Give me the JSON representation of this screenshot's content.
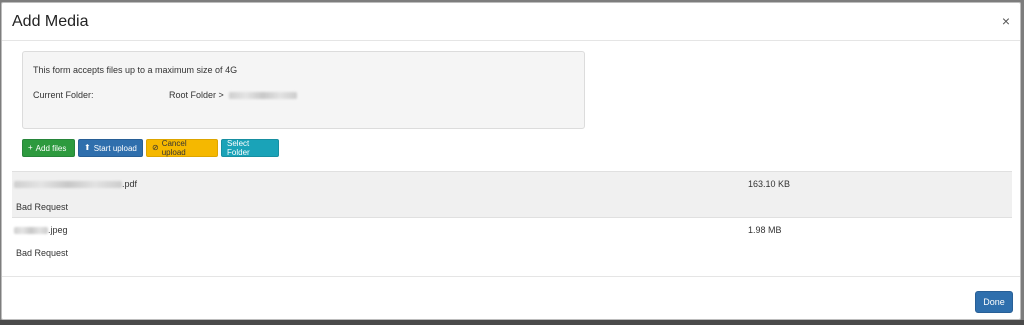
{
  "modal": {
    "title": "Add Media",
    "close_symbol": "×"
  },
  "info": {
    "max_size_text": "This form accepts files up to a maximum size of 4G",
    "current_folder_label": "Current Folder:",
    "current_folder_value": "Root Folder >"
  },
  "toolbar": {
    "add_files": {
      "label": "Add files",
      "icon": "plus-icon",
      "glyph": "+",
      "color": "#2d9a3e"
    },
    "start_upload": {
      "label": "Start upload",
      "icon": "upload-icon",
      "glyph": "⬆",
      "color": "#2f6fad"
    },
    "cancel_upload": {
      "label": "Cancel upload",
      "icon": "ban-icon",
      "glyph": "⊘",
      "color": "#f5b800"
    },
    "select_folder": {
      "label": "Select Folder",
      "color": "#1aa3b8"
    }
  },
  "files": [
    {
      "name_suffix": ".pdf",
      "size": "163.10 KB",
      "status": "Bad Request"
    },
    {
      "name_suffix": ".jpeg",
      "size": "1.98 MB",
      "status": "Bad Request"
    }
  ],
  "footer": {
    "done_label": "Done"
  }
}
